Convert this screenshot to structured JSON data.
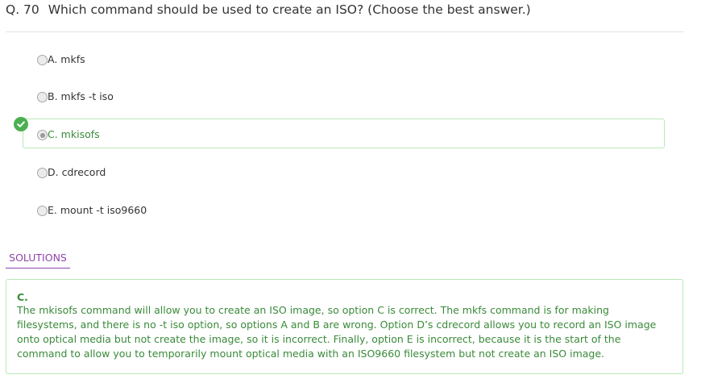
{
  "question": {
    "number": "Q. 70",
    "text": "Which command should be used to create an ISO? (Choose the best answer.)"
  },
  "options": [
    {
      "label": "A. mkfs",
      "selected": false,
      "correct": false
    },
    {
      "label": "B. mkfs -t iso",
      "selected": false,
      "correct": false
    },
    {
      "label": "C. mkisofs",
      "selected": true,
      "correct": true
    },
    {
      "label": "D. cdrecord",
      "selected": false,
      "correct": false
    },
    {
      "label": "E. mount -t iso9660",
      "selected": false,
      "correct": false
    }
  ],
  "solutions": {
    "tab_label": "SOLUTIONS",
    "answer": "C.",
    "explanation": "The mkisofs command will allow you to create an ISO image, so option C is correct. The mkfs command is for making filesystems, and there is no -t iso option, so options A and B are wrong. Option D’s cdrecord allows you to record an ISO image onto optical media but not create the image, so it is incorrect. Finally, option E is incorrect, because it is the start of the command to allow you to temporarily mount optical media with an ISO9660 filesystem but not create an ISO image."
  },
  "colors": {
    "correct_green": "#4caf50",
    "correct_text": "#3a8a3a",
    "correct_border": "#b8e8b8",
    "solutions_purple": "#8e44ad"
  },
  "icons": {
    "correct_indicator": "check-circle-icon"
  }
}
